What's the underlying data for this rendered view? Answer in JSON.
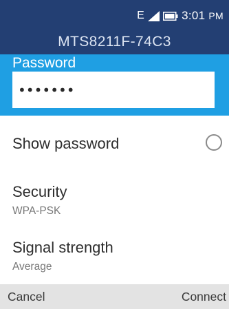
{
  "status_bar": {
    "network_type": "E",
    "time": "3:01",
    "time_suffix": "PM"
  },
  "header": {
    "title": "MTS8211F-74C3"
  },
  "password": {
    "label": "Password",
    "value": "•••••••"
  },
  "options": {
    "show_password": {
      "label": "Show password",
      "checked": false
    },
    "security": {
      "label": "Security",
      "value": "WPA-PSK"
    },
    "signal_strength": {
      "label": "Signal strength",
      "value": "Average"
    }
  },
  "softkeys": {
    "left": "Cancel",
    "right": "Connect"
  },
  "colors": {
    "header_bg": "#233f73",
    "accent": "#1f9fe3",
    "softkey_bg": "#e3e3e3"
  }
}
